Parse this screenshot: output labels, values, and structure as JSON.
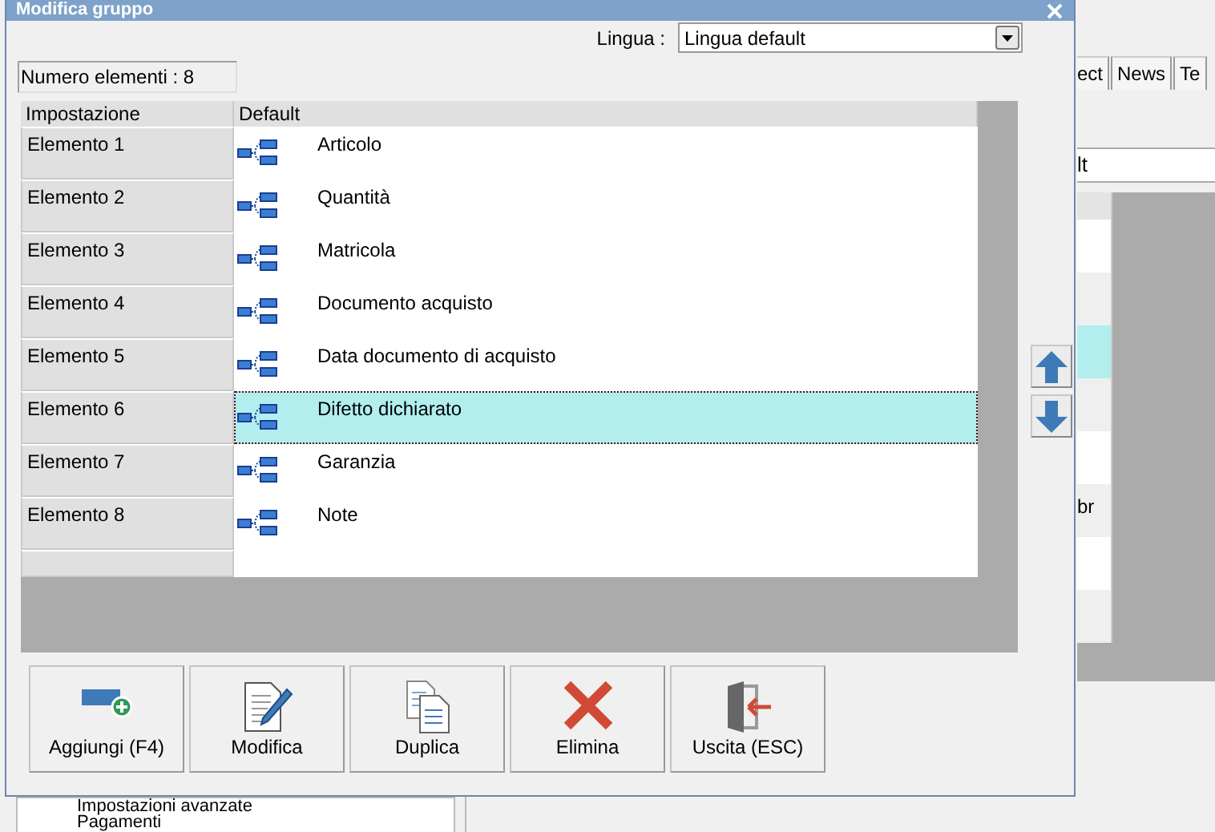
{
  "background_app": {
    "tabs": [
      {
        "label": "ect"
      },
      {
        "label": "News"
      },
      {
        "label": "Te"
      }
    ],
    "field": {
      "value": "lt"
    },
    "list_rows": [
      {
        "selected": false
      },
      {
        "selected": false
      },
      {
        "selected": true
      },
      {
        "selected": false
      },
      {
        "selected": false
      },
      {
        "selected": false,
        "text": "br"
      },
      {
        "selected": false
      },
      {
        "selected": false
      }
    ],
    "tree_items": [
      "Impostazioni avanzate",
      "Pagamenti"
    ]
  },
  "dialog": {
    "title": "Modifica gruppo",
    "language": {
      "label": "Lingua :",
      "value": "Lingua default"
    },
    "count": "Numero elementi : 8",
    "table": {
      "columns": [
        "Impostazione",
        "Default"
      ],
      "rows": [
        {
          "name": "Elemento 1",
          "value": "Articolo",
          "selected": false
        },
        {
          "name": "Elemento 2",
          "value": "Quantità",
          "selected": false
        },
        {
          "name": "Elemento 3",
          "value": "Matricola",
          "selected": false
        },
        {
          "name": "Elemento 4",
          "value": "Documento acquisto",
          "selected": false
        },
        {
          "name": "Elemento 5",
          "value": "Data documento di acquisto",
          "selected": false
        },
        {
          "name": "Elemento 6",
          "value": "Difetto dichiarato",
          "selected": true
        },
        {
          "name": "Elemento 7",
          "value": "Garanzia",
          "selected": false
        },
        {
          "name": "Elemento 8",
          "value": "Note",
          "selected": false
        }
      ]
    },
    "move_buttons": [
      {
        "kind": "up"
      },
      {
        "kind": "down"
      }
    ],
    "buttons": [
      {
        "label": "Aggiungi (F4)",
        "kind": "add"
      },
      {
        "label": "Modifica",
        "kind": "edit"
      },
      {
        "label": "Duplica",
        "kind": "duplicate"
      },
      {
        "label": "Elimina",
        "kind": "delete"
      },
      {
        "label": "Uscita (ESC)",
        "kind": "exit"
      }
    ]
  }
}
